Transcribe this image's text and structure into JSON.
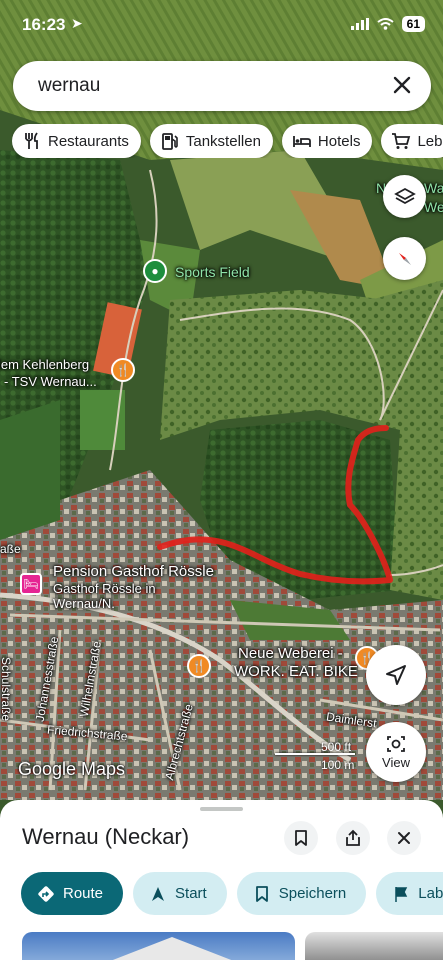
{
  "status_bar": {
    "time": "16:23",
    "battery": "61"
  },
  "search": {
    "query": "wernau"
  },
  "chips": [
    {
      "label": "Restaurants",
      "icon": "fork-knife-icon"
    },
    {
      "label": "Tankstellen",
      "icon": "gas-station-icon"
    },
    {
      "label": "Hotels",
      "icon": "bed-icon"
    },
    {
      "label": "Leb",
      "icon": "cart-icon"
    }
  ],
  "map": {
    "places": {
      "sports_field": "Sports Field",
      "kehlenberg_1": "lem Kehlenberg",
      "kehlenberg_2": "- TSV Wernau...",
      "pension_1": "Pension Gasthof Rössle",
      "pension_2": "Gasthof Rössle in",
      "pension_3": "Wernau/N.",
      "weberei_1": "Neue Weberei -",
      "weberei_2": "WORK. EAT. BIKE",
      "topright_1": "N",
      "topright_2": "Wa",
      "topright_3": "We",
      "left_edge": "aße"
    },
    "streets": {
      "schulstrasse": "Schulstraße",
      "johannesstrasse": "Johannesstraße",
      "wilhelmstrasse": "Wilhelmstraße",
      "friedrichstrasse": "Friedrichstraße",
      "albrechtstrasse": "Albrechtstraße",
      "daimlerstrasse": "Daimlerst"
    },
    "attribution": "Google Maps",
    "scale": {
      "feet": "500 ft",
      "meters": "100 m"
    },
    "view_label": "View"
  },
  "sheet": {
    "title": "Wernau (Neckar)",
    "actions": [
      {
        "label": "Route",
        "icon": "directions-icon"
      },
      {
        "label": "Start",
        "icon": "navigation-arrow-icon"
      },
      {
        "label": "Speichern",
        "icon": "bookmark-icon"
      },
      {
        "label": "Label",
        "icon": "flag-icon"
      }
    ]
  },
  "colors": {
    "route": "#e3201b",
    "primary_action": "#0b6876",
    "secondary_action": "#d3edf2"
  }
}
